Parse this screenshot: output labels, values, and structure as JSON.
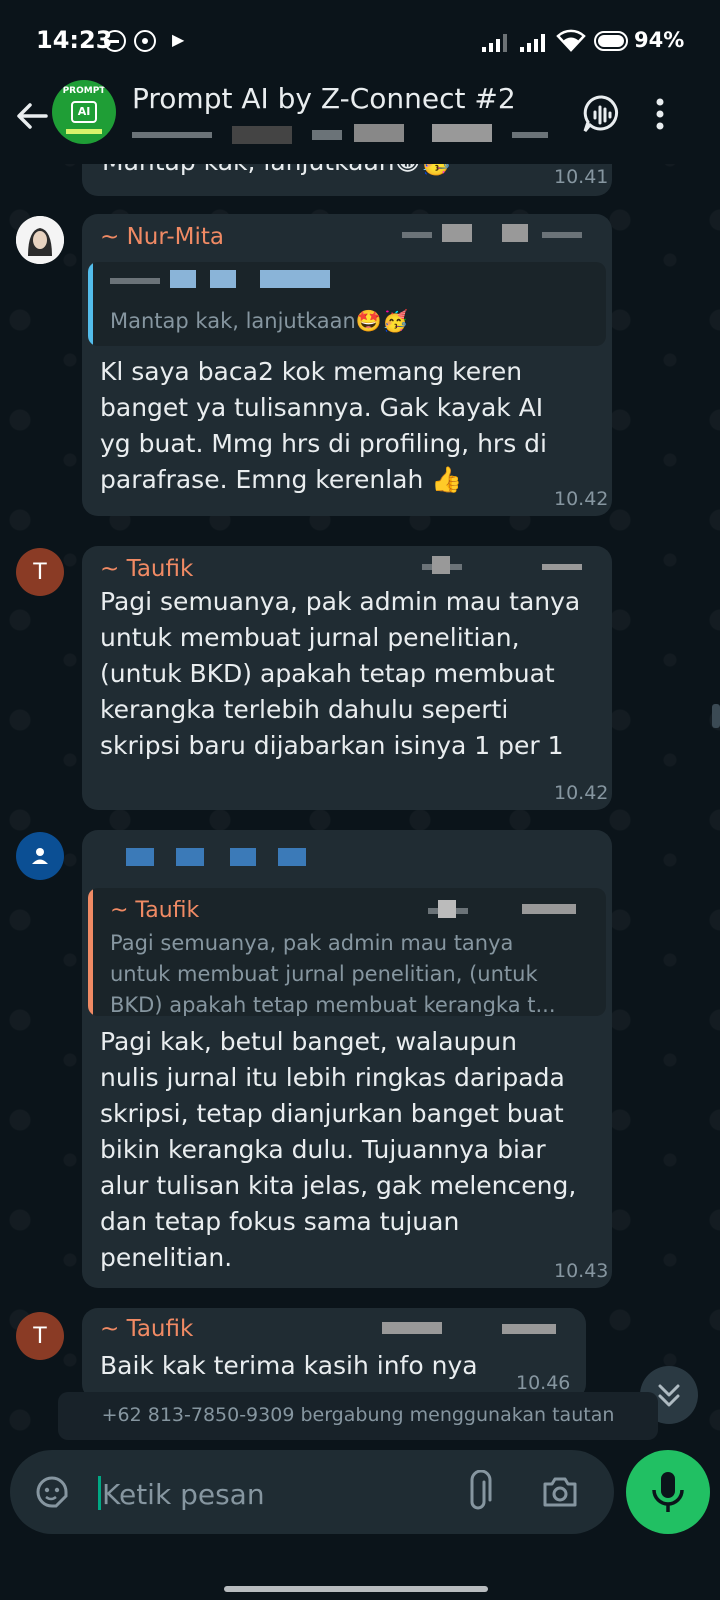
{
  "status_bar": {
    "time": "14:23",
    "battery": "94%"
  },
  "header": {
    "title": "Prompt AI by Z-Connect #2",
    "avatar_logo_text": "PROMPT",
    "avatar_logo_badge": "AI"
  },
  "messages": [
    {
      "text": "Mantap kak, lanjutkaan😁🥳",
      "time": "10.41"
    },
    {
      "sender": "~ Nur-Mita",
      "sender_color": "#f08a64",
      "quote": "Mantap kak, lanjutkaan🤩🥳",
      "text_lines": [
        "Kl saya baca2 kok memang keren",
        "banget ya tulisannya. Gak kayak AI",
        "yg buat. Mmg hrs di profiling, hrs di",
        "parafrase. Emng kerenlah 👍"
      ],
      "time": "10.42"
    },
    {
      "sender": "~ Taufik",
      "sender_color": "#f08a64",
      "avatar_letter": "T",
      "text_lines": [
        "Pagi semuanya, pak admin mau tanya",
        "untuk membuat jurnal penelitian,",
        "(untuk BKD) apakah tetap membuat",
        "kerangka terlebih dahulu seperti",
        "skripsi baru dijabarkan  isinya 1 per 1"
      ],
      "time": "10.42"
    },
    {
      "quote_sender": "~ Taufik",
      "quote_lines": [
        "Pagi semuanya, pak admin mau tanya",
        "untuk membuat jurnal penelitian, (untuk",
        "BKD) apakah tetap membuat kerangka t..."
      ],
      "text_lines": [
        "Pagi kak, betul banget, walaupun",
        "nulis jurnal itu lebih ringkas daripada",
        "skripsi, tetap dianjurkan banget buat",
        "bikin kerangka dulu. Tujuannya biar",
        "alur tulisan kita jelas, gak melenceng,",
        "dan tetap fokus sama tujuan",
        "penelitian."
      ],
      "time": "10.43"
    },
    {
      "sender": "~ Taufik",
      "sender_color": "#f08a64",
      "avatar_letter": "T",
      "text": "Baik kak terima kasih info nya",
      "time": "10.46"
    }
  ],
  "system_message": "+62 813-7850-9309 bergabung menggunakan tautan",
  "input": {
    "placeholder": "Ketik pesan"
  },
  "colors": {
    "background": "#0b141a",
    "bubble": "#202c33",
    "accent_green": "#21c063",
    "sender_orange": "#f08a64",
    "avatar_t": "#8a3b25",
    "avatar_person": "#0b4f94"
  },
  "icons": [
    "back-arrow-icon",
    "voice-chat-icon",
    "more-options-icon",
    "sticker-icon",
    "attach-icon",
    "camera-icon",
    "mic-icon",
    "chevron-double-down-icon",
    "person-icon"
  ]
}
